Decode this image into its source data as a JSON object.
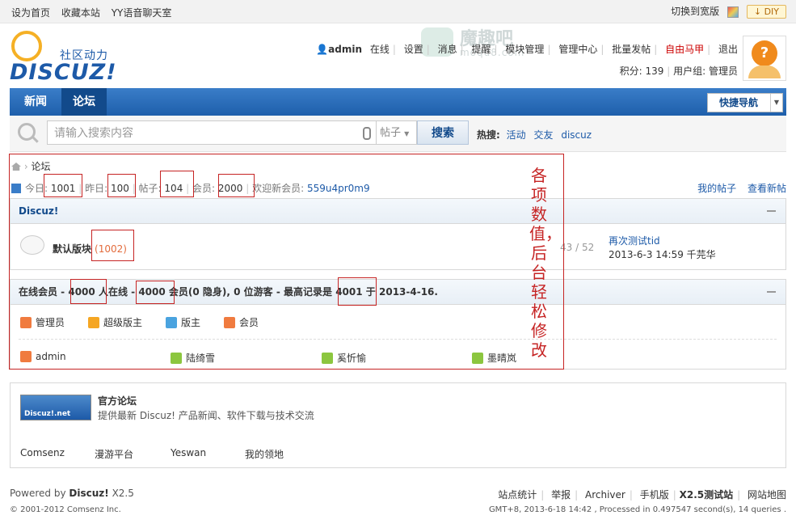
{
  "topbar": {
    "links": [
      "设为首页",
      "收藏本站",
      "YY语音聊天室"
    ],
    "switch_width": "切换到宽版",
    "diy": "DIY"
  },
  "logo": {
    "text": "DISCUZ!",
    "subtitle": "社区动力"
  },
  "watermark": {
    "name": "魔趣吧",
    "domain": "moqu8.com"
  },
  "user": {
    "name": "admin",
    "status": "在线",
    "links": [
      "设置",
      "消息",
      "提醒",
      "模块管理",
      "管理中心",
      "批量发帖",
      "自由马甲",
      "退出"
    ],
    "credits_label": "积分: 139",
    "group_label": "用户组: 管理员"
  },
  "nav": {
    "tabs": [
      "新闻",
      "论坛"
    ],
    "quick_nav": "快捷导航"
  },
  "search": {
    "placeholder": "请输入搜索内容",
    "type": "帖子",
    "button": "搜索",
    "hot_label": "热搜:",
    "hot_terms": [
      "活动",
      "交友",
      "discuz"
    ]
  },
  "breadcrumb": {
    "current": "论坛"
  },
  "stats": {
    "today_label": "今日:",
    "today": "1001",
    "yesterday_label": "昨日:",
    "yesterday": "100",
    "posts_label": "帖子:",
    "posts": "104",
    "members_label": "会员:",
    "members": "2000",
    "welcome_label": "欢迎新会员:",
    "new_member": "559u4pr0m9",
    "my_posts": "我的帖子",
    "new_posts": "查看新帖"
  },
  "forum_group": {
    "title": "Discuz!",
    "forum": {
      "name": "默认版块",
      "count": "(1002)",
      "posts": "43 / 52",
      "last_title": "再次测试tid",
      "last_time": "2013-6-3 14:59 千芫华"
    }
  },
  "online": {
    "prefix": "在线会员 -",
    "total": "4000",
    "mid1": "人在线 -",
    "members": "4000",
    "mid2": "会员(0 隐身), 0 位游客 - 最高记录是",
    "record": "4001",
    "mid3": "于",
    "date": "2013-4-16.",
    "legend": [
      {
        "label": "管理员",
        "color": "#f07b3f"
      },
      {
        "label": "超级版主",
        "color": "#f5a623"
      },
      {
        "label": "版主",
        "color": "#4aa3df"
      },
      {
        "label": "会员",
        "color": "#f07b3f"
      }
    ],
    "users": [
      {
        "name": "admin",
        "color": "#f07b3f"
      },
      {
        "name": "陆绮雪",
        "color": "#8cc63f"
      },
      {
        "name": "奚忻愉",
        "color": "#8cc63f"
      },
      {
        "name": "墨晴岚",
        "color": "#8cc63f"
      }
    ]
  },
  "annotation": "各项数值，后台轻松修改",
  "links": {
    "logo_text": "Discuz!.net",
    "title": "官方论坛",
    "desc": "提供最新 Discuz! 产品新闻、软件下载与技术交流",
    "items": [
      "Comsenz",
      "漫游平台",
      "Yeswan",
      "我的领地"
    ]
  },
  "footer": {
    "powered": "Powered by",
    "brand": "Discuz!",
    "version": "X2.5",
    "copyright": "© 2001-2012 Comsenz Inc.",
    "links": [
      "站点统计",
      "举报",
      "Archiver",
      "手机版",
      "X2.5测试站",
      "网站地图"
    ],
    "info": "GMT+8, 2013-6-18 14:42 , Processed in 0.497547 second(s), 14 queries ."
  }
}
